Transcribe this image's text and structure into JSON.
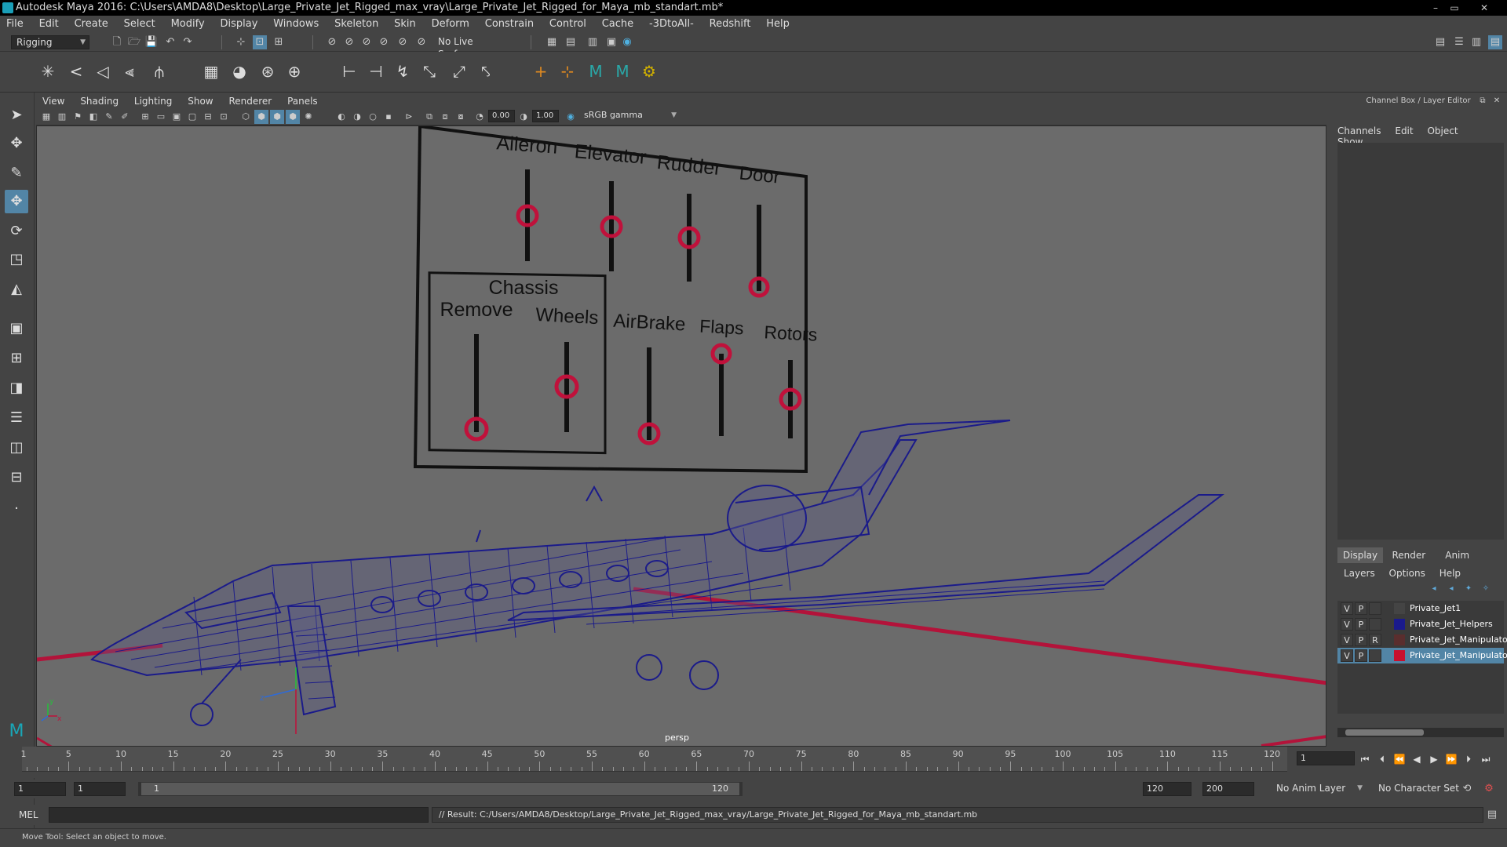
{
  "window": {
    "title": "Autodesk Maya 2016: C:\\Users\\AMDA8\\Desktop\\Large_Private_Jet_Rigged_max_vray\\Large_Private_Jet_Rigged_for_Maya_mb_standart.mb*",
    "minimize": "–",
    "restore": "▭",
    "close": "✕"
  },
  "menubar": [
    "File",
    "Edit",
    "Create",
    "Select",
    "Modify",
    "Display",
    "Windows",
    "Skeleton",
    "Skin",
    "Deform",
    "Constrain",
    "Control",
    "Cache",
    "-3DtoAll-",
    "Redshift",
    "Help"
  ],
  "statusline": {
    "menuset": "Rigging",
    "live_surface": "No Live Surface"
  },
  "viewport": {
    "menu": [
      "View",
      "Shading",
      "Lighting",
      "Show",
      "Renderer",
      "Panels"
    ],
    "exposure": "0.00",
    "gamma": "1.00",
    "colorspace": "sRGB gamma",
    "camera_label": "persp",
    "rig_panel": {
      "top_labels": [
        "Aileron",
        "Elevator",
        "Rudder",
        "Door"
      ],
      "chassis_title": "Chassis",
      "chassis_labels": [
        "Remove",
        "Wheels"
      ],
      "bottom_labels": [
        "AirBrake",
        "Flaps",
        "Rotors"
      ]
    },
    "axis": {
      "x": "x",
      "y": "y",
      "z": "z"
    }
  },
  "channelbox": {
    "title": "Channel Box / Layer Editor",
    "menu": [
      "Channels",
      "Edit",
      "Object",
      "Show"
    ],
    "tabs": [
      "Display",
      "Render",
      "Anim"
    ],
    "active_tab": "Display",
    "layer_menu": [
      "Layers",
      "Options",
      "Help"
    ],
    "layers": [
      {
        "v": "V",
        "p": "P",
        "r": "",
        "name": "Private_Jet1",
        "color": "#444444",
        "selected": false
      },
      {
        "v": "V",
        "p": "P",
        "r": "",
        "name": "Private_Jet_Helpers",
        "color": "#1a1a8c",
        "selected": false
      },
      {
        "v": "V",
        "p": "P",
        "r": "R",
        "name": "Private_Jet_Manipulators",
        "color": "#5a2e2e",
        "selected": false
      },
      {
        "v": "V",
        "p": "P",
        "r": "",
        "name": "Private_Jet_Manipulators",
        "color": "#c8102e",
        "selected": true
      }
    ]
  },
  "timeline": {
    "ticks": [
      "5",
      "10",
      "15",
      "20",
      "25",
      "30",
      "35",
      "40",
      "45",
      "50",
      "55",
      "60",
      "65",
      "70",
      "75",
      "80",
      "85",
      "90",
      "95",
      "100",
      "105",
      "110",
      "115",
      "120"
    ],
    "start_marker": "1",
    "current_frame": "1"
  },
  "range": {
    "start": "1",
    "playback_start": "1",
    "slider_start": "1",
    "slider_end": "120",
    "playback_end": "120",
    "end": "200",
    "anim_layer": "No Anim Layer",
    "character_set": "No Character Set"
  },
  "cmdline": {
    "label": "MEL",
    "result": "// Result: C:/Users/AMDA8/Desktop/Large_Private_Jet_Rigged_max_vray/Large_Private_Jet_Rigged_for_Maya_mb_standart.mb"
  },
  "helpline": "Move Tool: Select an object to move."
}
